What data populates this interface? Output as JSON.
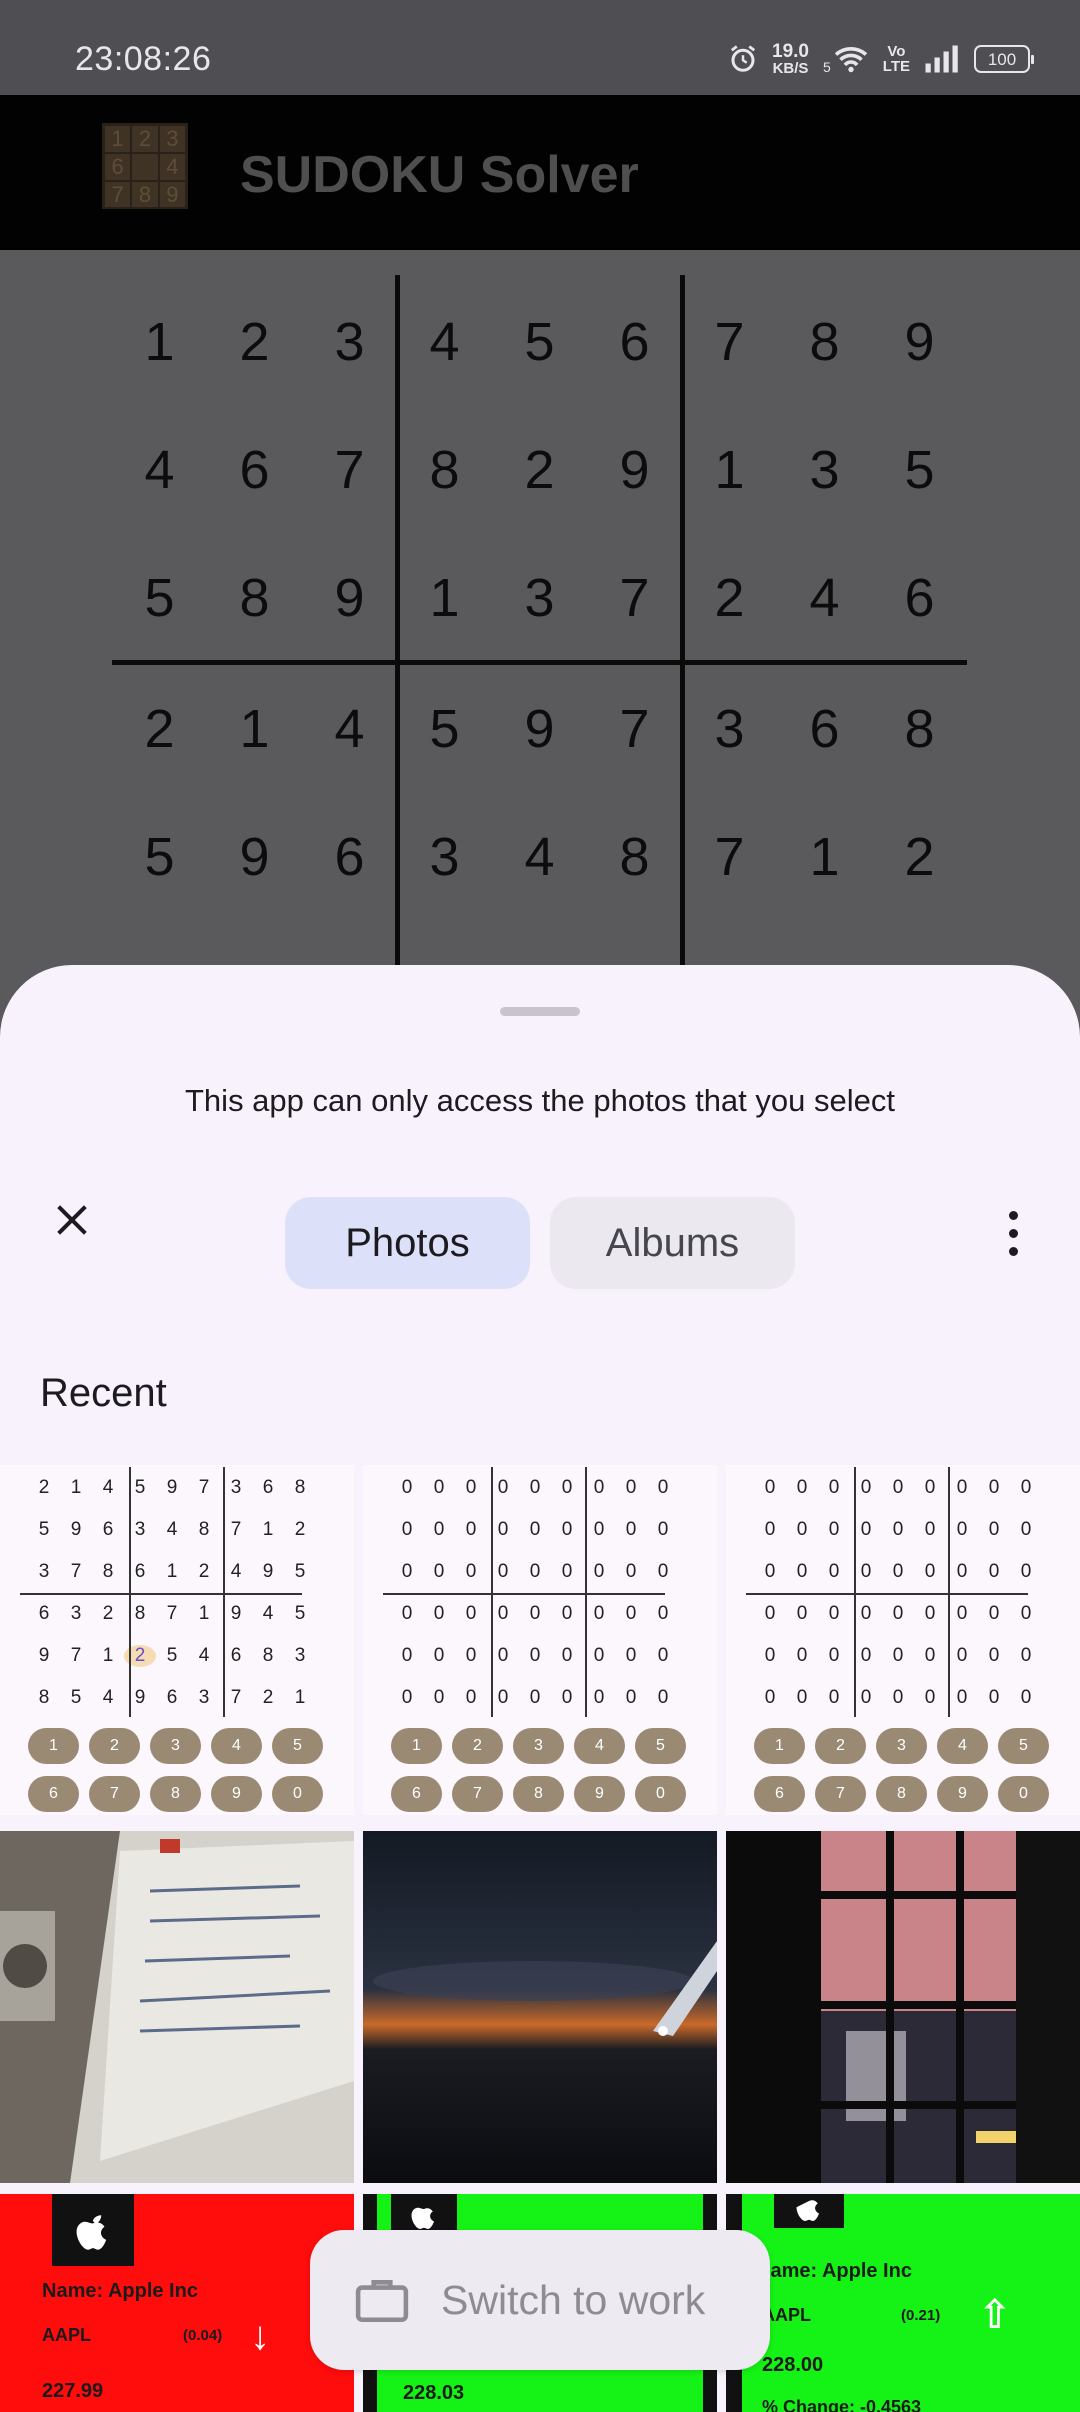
{
  "status_bar": {
    "time": "23:08:26",
    "speed_value": "19.0",
    "speed_unit": "KB/S",
    "wifi_label": "5",
    "volte_top": "Vo",
    "volte_bottom": "LTE",
    "battery": "100"
  },
  "app_bar": {
    "title": "SUDOKU Solver",
    "logo_digits": [
      "1",
      "2",
      "3",
      "6",
      "",
      "4",
      "7",
      "8",
      "9"
    ]
  },
  "board": {
    "rows": [
      [
        "1",
        "2",
        "3",
        "4",
        "5",
        "6",
        "7",
        "8",
        "9"
      ],
      [
        "4",
        "6",
        "7",
        "8",
        "2",
        "9",
        "1",
        "3",
        "5"
      ],
      [
        "5",
        "8",
        "9",
        "1",
        "3",
        "7",
        "2",
        "4",
        "6"
      ],
      [
        "2",
        "1",
        "4",
        "5",
        "9",
        "7",
        "3",
        "6",
        "8"
      ],
      [
        "5",
        "9",
        "6",
        "3",
        "4",
        "8",
        "7",
        "1",
        "2"
      ]
    ]
  },
  "picker": {
    "notice": "This app can only access the photos that you select",
    "tabs": {
      "photos": "Photos",
      "albums": "Albums"
    },
    "section_title": "Recent",
    "thumb1_rows": [
      [
        "2",
        "1",
        "4",
        "5",
        "9",
        "7",
        "3",
        "6",
        "8"
      ],
      [
        "5",
        "9",
        "6",
        "3",
        "4",
        "8",
        "7",
        "1",
        "2"
      ],
      [
        "3",
        "7",
        "8",
        "6",
        "1",
        "2",
        "4",
        "9",
        "5"
      ],
      [
        "6",
        "3",
        "2",
        "8",
        "7",
        "1",
        "9",
        "4",
        "5"
      ],
      [
        "9",
        "7",
        "1",
        "2",
        "5",
        "4",
        "6",
        "8",
        "3"
      ],
      [
        "8",
        "5",
        "4",
        "9",
        "6",
        "3",
        "7",
        "2",
        "1"
      ]
    ],
    "zero_row": [
      "0",
      "0",
      "0",
      "0",
      "0",
      "0",
      "0",
      "0",
      "0"
    ],
    "keypad_row1": [
      "1",
      "2",
      "3",
      "4",
      "5"
    ],
    "keypad_row2": [
      "6",
      "7",
      "8",
      "9",
      "0"
    ],
    "stock_cards": [
      {
        "name": "Name: Apple Inc",
        "ticker": "AAPL",
        "change": "(0.04)",
        "price": "227.99",
        "bg": "#ff0c0c"
      },
      {
        "price": "228.03",
        "bg": "#15f215"
      },
      {
        "name": "Name: Apple Inc",
        "ticker": "AAPL",
        "change": "(0.21)",
        "price": "228.00",
        "pct": "% Change: -0.4563",
        "bg": "#15f215"
      }
    ],
    "switch_work": "Switch to work"
  },
  "colors": {
    "accent_tab": "#dde0f9",
    "sheet_bg": "#f7f2fb",
    "scrim": "#5a595c"
  }
}
